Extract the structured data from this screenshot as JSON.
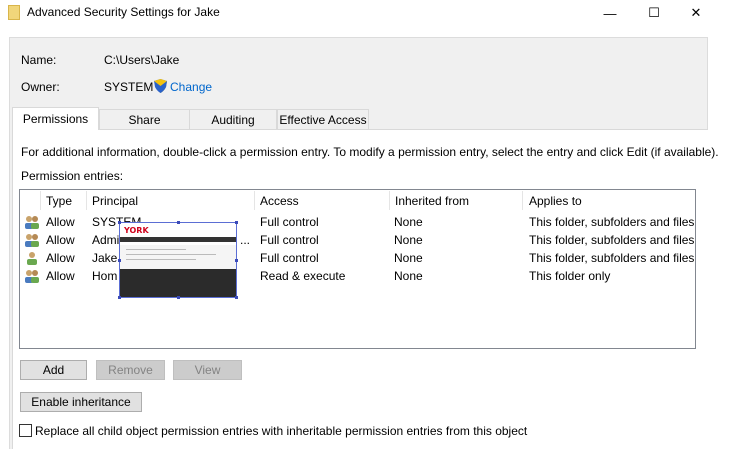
{
  "window": {
    "title": "Advanced Security Settings for Jake",
    "minimize_glyph": "—",
    "maximize_glyph": "☐",
    "close_glyph": "✕"
  },
  "info": {
    "name_label": "Name:",
    "name_value": "C:\\Users\\Jake",
    "owner_label": "Owner:",
    "owner_value": "SYSTEM",
    "change_link": "Change"
  },
  "tabs": [
    {
      "label": "Permissions"
    },
    {
      "label": "Share"
    },
    {
      "label": "Auditing"
    },
    {
      "label": "Effective Access"
    }
  ],
  "permissions": {
    "instructions": "For additional information, double-click a permission entry. To modify a permission entry, select the entry and click Edit (if available).",
    "entries_label": "Permission entries:",
    "columns": [
      "Type",
      "Principal",
      "Access",
      "Inherited from",
      "Applies to"
    ],
    "rows": [
      {
        "type": "Allow",
        "principal": "SYSTEM",
        "access": "Full control",
        "inherited": "None",
        "applies": "This folder, subfolders and files"
      },
      {
        "type": "Allow",
        "principal": "Admi",
        "access": "Full control",
        "inherited": "None",
        "applies": "This folder, subfolders and files"
      },
      {
        "type": "Allow",
        "principal": "Jake",
        "access": "Full control",
        "inherited": "None",
        "applies": "This folder, subfolders and files"
      },
      {
        "type": "Allow",
        "principal": "Hom",
        "access": "Read & execute",
        "inherited": "None",
        "applies": "This folder only"
      }
    ],
    "ellipsis": "..."
  },
  "popup": {
    "logo": "YORK"
  },
  "buttons": {
    "add": "Add",
    "remove": "Remove",
    "view": "View",
    "enable_inheritance": "Enable inheritance"
  },
  "replace_checkbox": {
    "label": "Replace all child object permission entries with inheritable permission entries from this object",
    "checked": false
  },
  "colors": {
    "link": "#0066cc",
    "grid_border": "#828790",
    "selection_handle": "#3b4bb8"
  }
}
